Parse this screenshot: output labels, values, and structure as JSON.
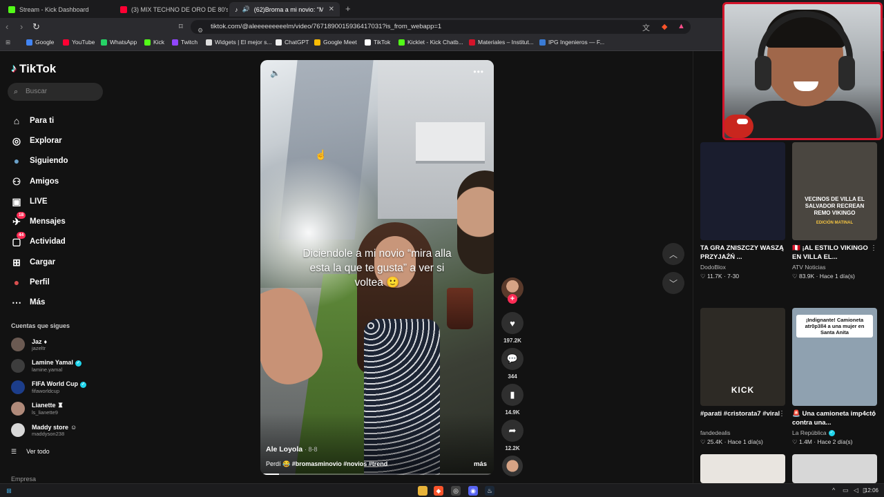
{
  "browser": {
    "tabs": [
      {
        "title": "Stream - Kick Dashboard",
        "color": "#53fc18"
      },
      {
        "title": "(3) MIX TECHNO DE ORO DE 80's &",
        "color": "#ff0033"
      },
      {
        "title": "(62)Broma a mi novio: \"Mira a",
        "color": "#ffffff"
      }
    ],
    "new_tab_icon": "plus-icon",
    "url": "tiktok.com/@aleeeeeeeeelm/video/7671890015936417031?is_from_webapp=1",
    "bookmarks": [
      {
        "label": "Google",
        "color": "#4285f4"
      },
      {
        "label": "YouTube",
        "color": "#ff0033"
      },
      {
        "label": "WhatsApp",
        "color": "#25d366"
      },
      {
        "label": "Kick",
        "color": "#53fc18"
      },
      {
        "label": "Twitch",
        "color": "#9146ff"
      },
      {
        "label": "Widgets | El mejor s...",
        "color": "#dddddd"
      },
      {
        "label": "ChatGPT",
        "color": "#eeeeee"
      },
      {
        "label": "Google Meet",
        "color": "#fbbc04"
      },
      {
        "label": "TikTok",
        "color": "#ffffff"
      },
      {
        "label": "Kicklet - Kick Chatb...",
        "color": "#53fc18"
      },
      {
        "label": "Materiales – Institut...",
        "color": "#d4142a"
      },
      {
        "label": "IPG Ingenieros — F...",
        "color": "#3a7bd5"
      }
    ]
  },
  "sidebar": {
    "logo": "TikTok",
    "search_placeholder": "Buscar",
    "nav": [
      {
        "label": "Para ti",
        "icon": "home-icon",
        "glyph": "⌂"
      },
      {
        "label": "Explorar",
        "icon": "compass-icon",
        "glyph": "◎"
      },
      {
        "label": "Siguiendo",
        "icon": "following-avatar-icon",
        "glyph": "●"
      },
      {
        "label": "Amigos",
        "icon": "friends-icon",
        "glyph": "⚇"
      },
      {
        "label": "LIVE",
        "icon": "live-icon",
        "glyph": "▣"
      },
      {
        "label": "Mensajes",
        "icon": "messages-icon",
        "glyph": "✈",
        "badge": "18"
      },
      {
        "label": "Actividad",
        "icon": "activity-icon",
        "glyph": "▢",
        "badge": "44"
      },
      {
        "label": "Cargar",
        "icon": "upload-icon",
        "glyph": "⊞"
      },
      {
        "label": "Perfil",
        "icon": "profile-avatar-icon",
        "glyph": "●"
      },
      {
        "label": "Más",
        "icon": "more-icon",
        "glyph": "⋯"
      }
    ],
    "following_title": "Cuentas que sigues",
    "accounts": [
      {
        "name": "Jaz",
        "suffix": "♦",
        "handle": "jazeltr",
        "verified": false,
        "color": "#6b5a52"
      },
      {
        "name": "Lamine Yamal",
        "suffix": "",
        "handle": "lamine.yamal",
        "verified": true,
        "color": "#3d3d3d"
      },
      {
        "name": "FIFA World Cup",
        "suffix": "",
        "handle": "fifaworldcup",
        "verified": true,
        "color": "#1c3d8a"
      },
      {
        "name": "Lianette",
        "suffix": "♜",
        "handle": "ls_lianette9",
        "verified": false,
        "color": "#b08a7a"
      },
      {
        "name": "Maddy store",
        "suffix": "☺",
        "handle": "maddyson238",
        "verified": false,
        "color": "#d8d8d8"
      }
    ],
    "see_all": "Ver todo",
    "footer": "Empresa"
  },
  "video": {
    "overlay_text": "Diciendole a mi novio “mira alla esta la que te gusta” a ver si voltea 🙂",
    "author": "Ale Loyola",
    "date": "8-8",
    "desc_prefix": "Perdí 😂",
    "desc_tags": "#bromasminovio #novios #trend",
    "more": "más",
    "progress": 0.08
  },
  "actions": {
    "likes": "197.2K",
    "comments": "344",
    "saves": "14.9K",
    "shares": "12.2K"
  },
  "recommended": [
    {
      "title": "TA GRA ZNISZCZY WASZĄ PRZYJAŹŃ ...",
      "author": "DodoBlox",
      "verified": false,
      "views": "11.7K",
      "date": "7-30",
      "thumb_text": "",
      "bg": "#1a1d2e"
    },
    {
      "title": "🇵🇪 ¡AL ESTILO VIKINGO EN VILLA EL...",
      "author": "ATV Noticias",
      "verified": false,
      "views": "83.9K",
      "date": "Hace 1 día(s)",
      "thumb_text": "VECINOS DE VILLA EL SALVADOR RECREAN REMO VIKINGO",
      "thumb_sub": "EDICIÓN MATINAL",
      "bg": "#4a4640"
    },
    {
      "title": "#parati #cristorata7 #viral",
      "author": "fandedealis",
      "verified": false,
      "views": "25.4K",
      "date": "Hace 1 día(s)",
      "thumb_text": "KICK",
      "bg": "#2d2a25"
    },
    {
      "title": "🚨 Una camioneta imp4ctó contra una...",
      "author": "La República",
      "verified": true,
      "views": "1.4M",
      "date": "Hace 2 día(s)",
      "thumb_text": "¡Indignante! Camioneta atr0p3ll4 a una mujer en Santa Anita",
      "bg": "#8fa1b0"
    }
  ],
  "taskbar": {
    "time": "12:06"
  }
}
